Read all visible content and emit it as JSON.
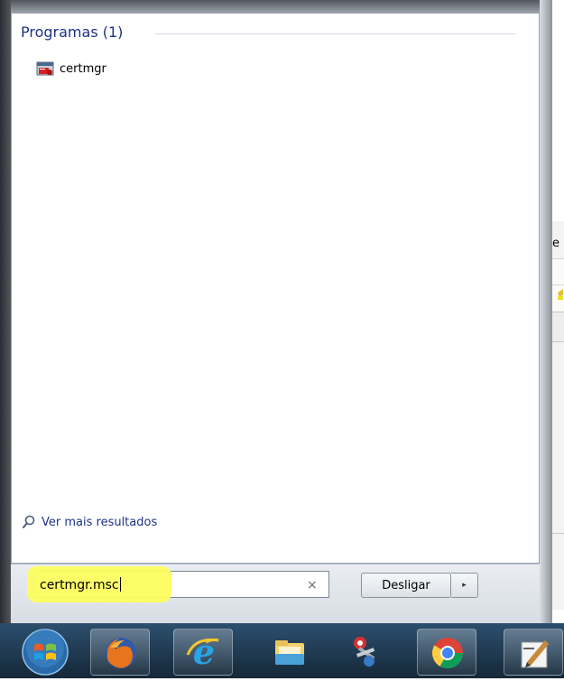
{
  "background_window": {
    "partial_text": "e"
  },
  "start_menu": {
    "section_header": "Programas (1)",
    "results": [
      {
        "label": "certmgr",
        "icon": "certmgr-icon"
      }
    ],
    "see_more_label": "Ver mais resultados",
    "search": {
      "value": "certmgr.msc",
      "clear_glyph": "×"
    },
    "shutdown_label": "Desligar",
    "shutdown_arrow_glyph": "▸"
  },
  "taskbar": {
    "start_icon": "windows-start-orb",
    "pinned": [
      {
        "name": "firefox",
        "icon": "firefox-icon",
        "active": true
      },
      {
        "name": "internet-explorer",
        "icon": "ie-icon",
        "active": true
      },
      {
        "name": "file-explorer",
        "icon": "folder-icon",
        "active": false
      },
      {
        "name": "snipping-tool",
        "icon": "scissors-icon",
        "active": false
      },
      {
        "name": "chrome",
        "icon": "chrome-icon",
        "active": true
      },
      {
        "name": "app",
        "icon": "edit-app-icon",
        "active": true
      }
    ]
  },
  "colors": {
    "header_blue": "#1e3287",
    "highlight_yellow": "#fdfd60",
    "taskbar": "#1f3a52"
  }
}
